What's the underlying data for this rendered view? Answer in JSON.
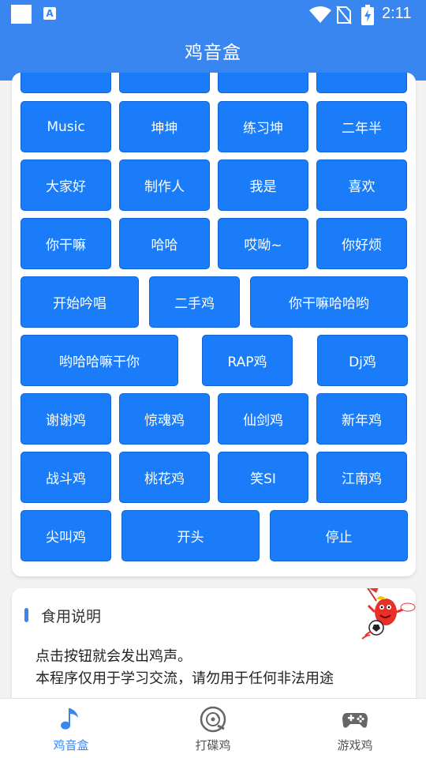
{
  "status_bar": {
    "time": "2:11",
    "app_icon_letter": "A"
  },
  "app_bar": {
    "title": "鸡音盒"
  },
  "grid": {
    "row0": [
      "",
      "",
      "",
      ""
    ],
    "row1": [
      "Music",
      "坤坤",
      "练习坤",
      "二年半"
    ],
    "row2": [
      "大家好",
      "制作人",
      "我是",
      "喜欢"
    ],
    "row3": [
      "你干嘛",
      "哈哈",
      "哎呦~",
      "你好烦"
    ],
    "row4": [
      "开始吟唱",
      "二手鸡",
      "你干嘛哈哈哟"
    ],
    "row5": [
      "哟哈哈嘛干你",
      "RAP鸡",
      "Dj鸡"
    ],
    "row6": [
      "谢谢鸡",
      "惊魂鸡",
      "仙剑鸡",
      "新年鸡"
    ],
    "row7": [
      "战斗鸡",
      "桃花鸡",
      "笑SI",
      "江南鸡"
    ],
    "row8": [
      "尖叫鸡",
      "开头",
      "停止"
    ]
  },
  "instructions": {
    "title": "食用说明",
    "line1": "点击按钮就会发出鸡声。",
    "line2": "本程序仅用于学习交流，请勿用于任何非法用途"
  },
  "bottom_nav": {
    "items": [
      {
        "label": "鸡音盒",
        "icon": "music-note-icon",
        "active": true
      },
      {
        "label": "打碟鸡",
        "icon": "disc-icon",
        "active": false
      },
      {
        "label": "游戏鸡",
        "icon": "gamepad-icon",
        "active": false
      }
    ]
  },
  "colors": {
    "primary": "#3a86f0",
    "button": "#1a7cf8",
    "background": "#f2f2f2"
  }
}
